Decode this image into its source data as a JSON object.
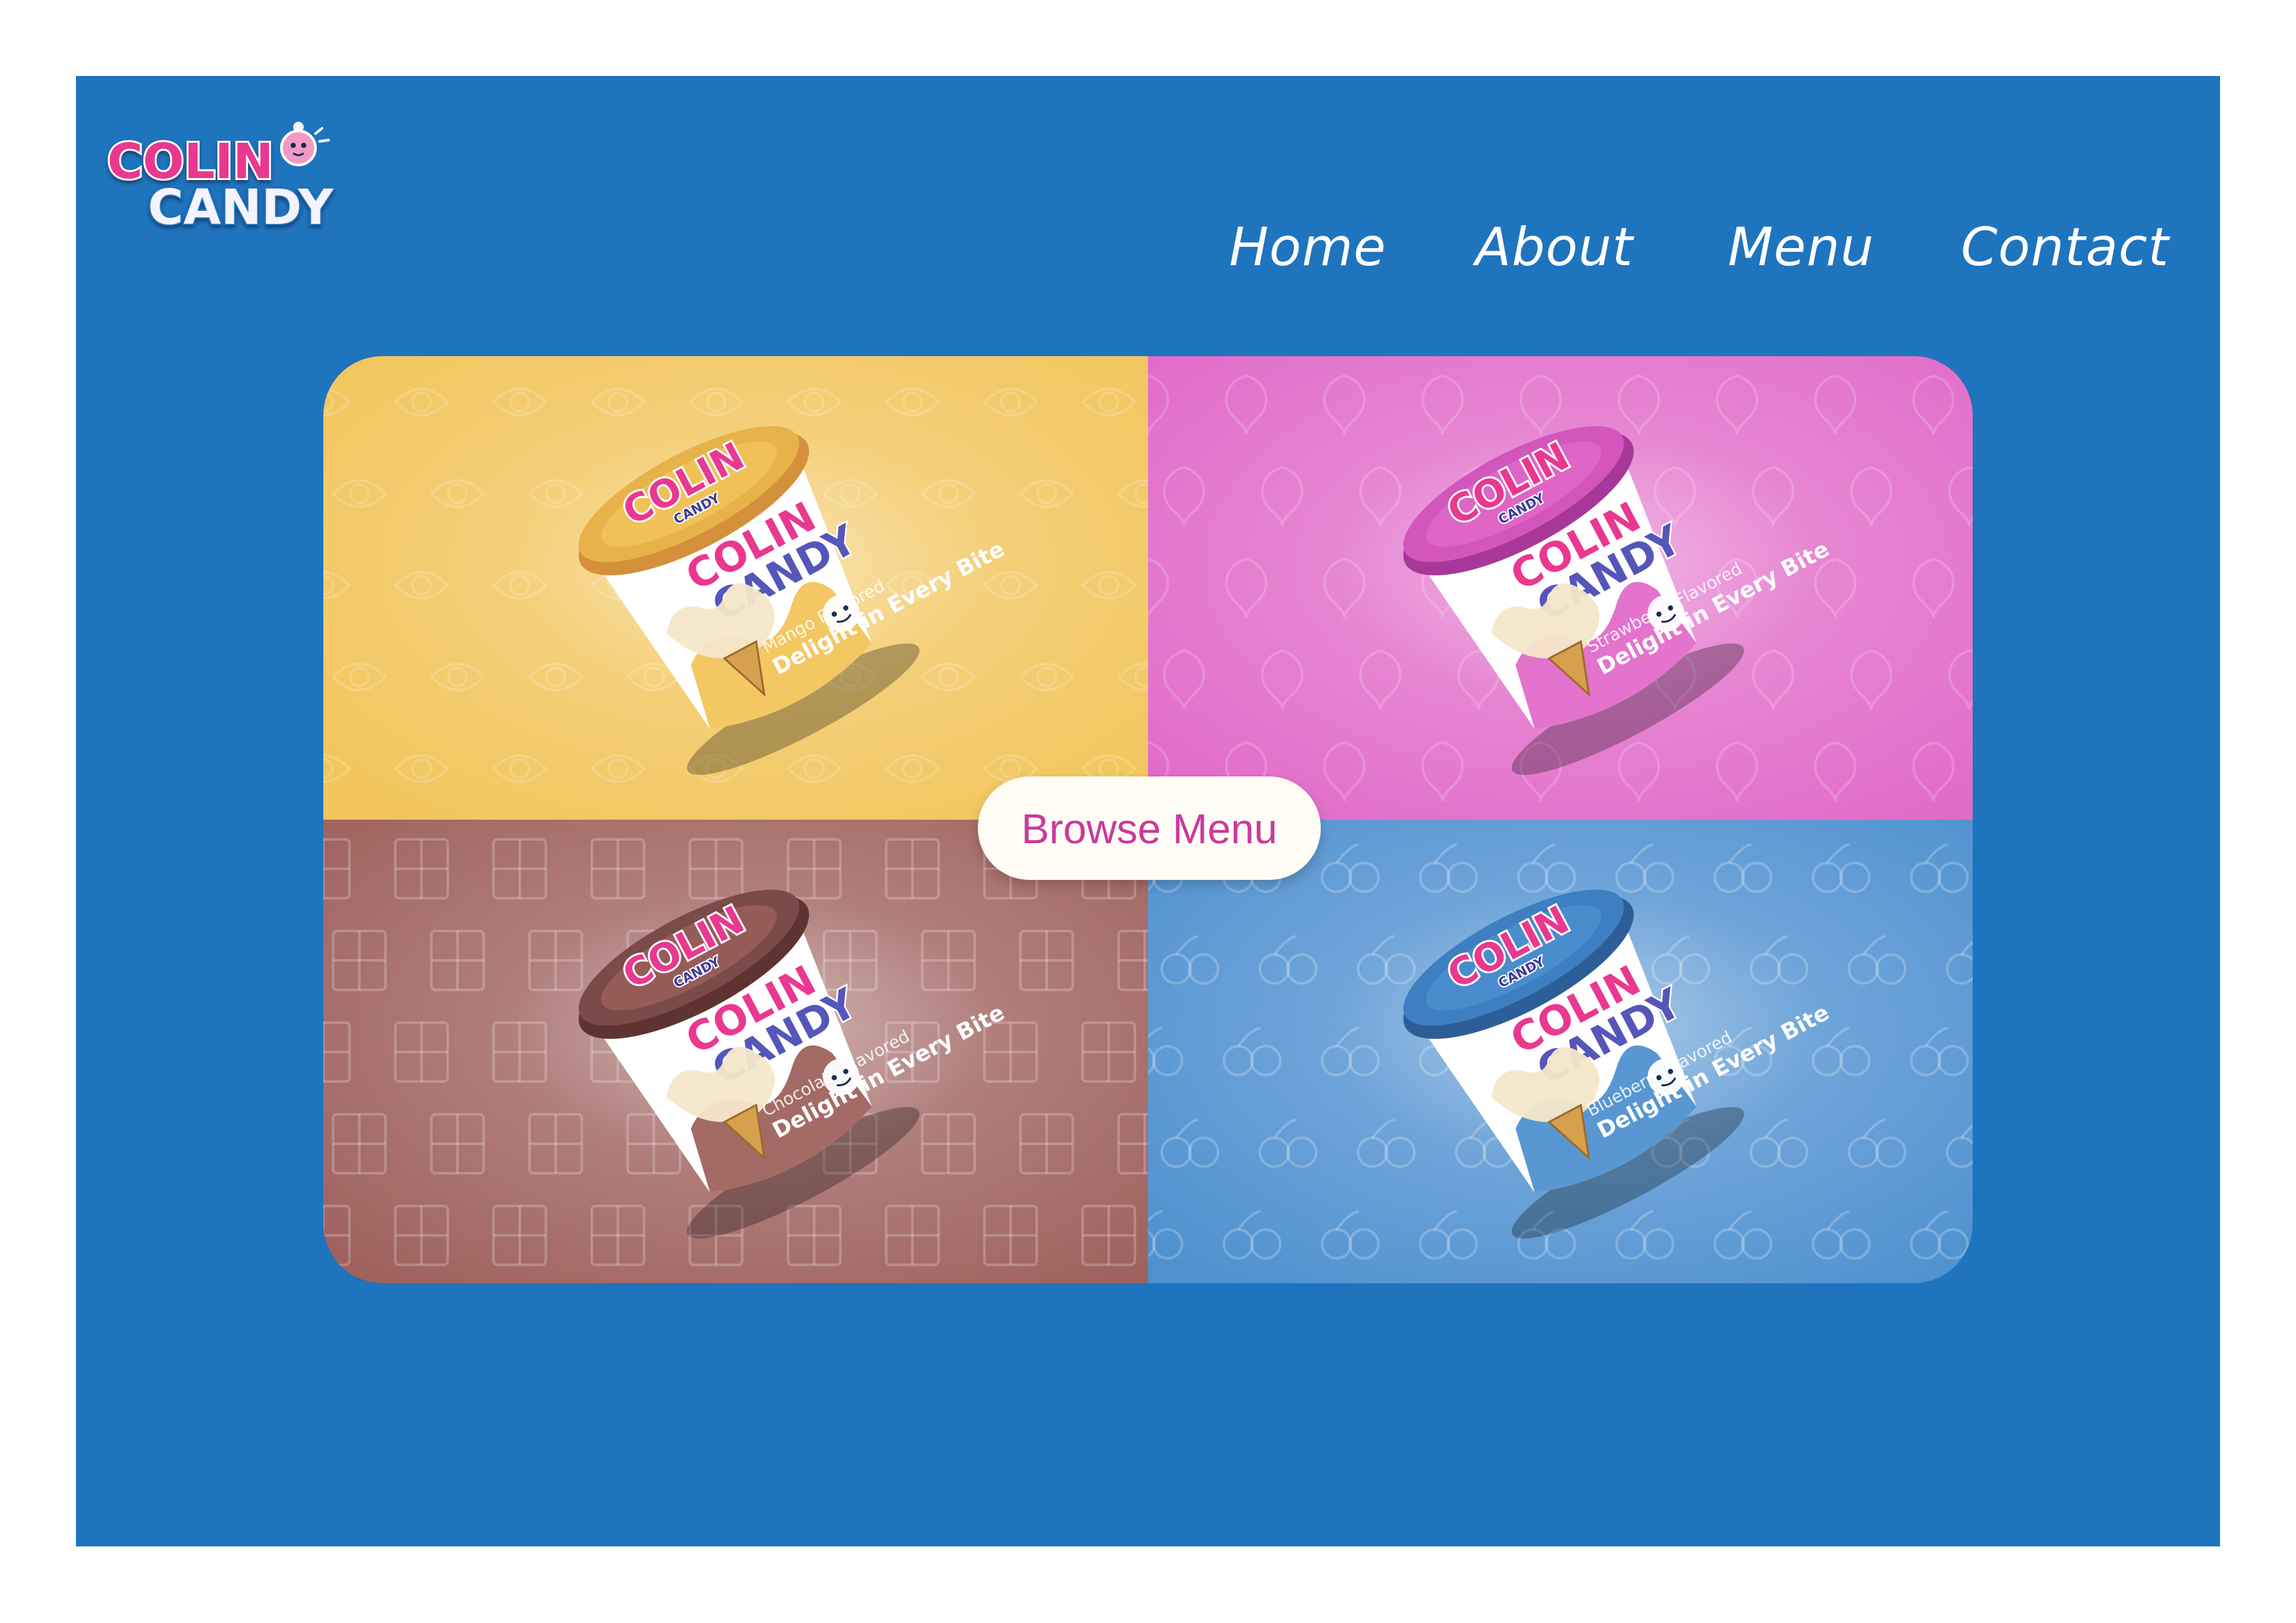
{
  "header": {
    "logo": {
      "line1": "COLIN",
      "line2": "CANDY"
    },
    "nav": [
      {
        "label": "Home"
      },
      {
        "label": "About"
      },
      {
        "label": "Menu"
      },
      {
        "label": "Contact"
      }
    ]
  },
  "gallery": {
    "tiles": [
      {
        "name": "yellow",
        "flavor_name": "Mango",
        "label_line1": "COLIN",
        "label_line2": "CANDY",
        "lid_top": "COLIN",
        "lid_bottom": "CANDY",
        "tagline_line1": "Mango Flavored",
        "tagline_line2": "Delight in Every Bite",
        "bg": "#f2c55b",
        "lid": "#e8b24a",
        "accent": "#d4903b"
      },
      {
        "name": "pink",
        "flavor_name": "Strawberry",
        "label_line1": "COLIN",
        "label_line2": "CANDY",
        "lid_top": "COLIN",
        "lid_bottom": "CANDY",
        "tagline_line1": "Strawberry Flavored",
        "tagline_line2": "Delight in Every Bite",
        "bg": "#e16bc9",
        "lid": "#d256bb",
        "accent": "#a7389a"
      },
      {
        "name": "brown",
        "flavor_name": "Chocolate",
        "label_line1": "COLIN",
        "label_line2": "CANDY",
        "lid_top": "COLIN",
        "lid_bottom": "CANDY",
        "tagline_line1": "Chocolate Flavored",
        "tagline_line2": "Delight in Every Bite",
        "bg": "#9f625e",
        "lid": "#7a4b48",
        "accent": "#5e3431"
      },
      {
        "name": "blue",
        "flavor_name": "Blueberry",
        "label_line1": "COLIN",
        "label_line2": "CANDY",
        "lid_top": "COLIN",
        "lid_bottom": "CANDY",
        "tagline_line1": "Blueberry Flavored",
        "tagline_line2": "Delight in Every Bite",
        "bg": "#4f91d0",
        "lid": "#3d7fc0",
        "accent": "#2d5e97"
      }
    ],
    "cta_label": "Browse Menu"
  },
  "colors": {
    "page_bg": "#1f74be",
    "nav_text": "#ffffff",
    "cta_text": "#c93a9b",
    "cta_bg": "#fffdf6",
    "logo_pink": "#e9388f",
    "logo_outline": "#ffffff"
  }
}
